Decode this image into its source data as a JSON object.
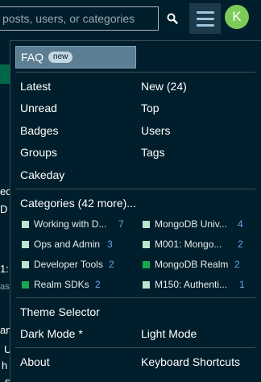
{
  "header": {
    "search_placeholder": "posts, users, or categories",
    "avatar_letter": "K"
  },
  "page_edge": {
    "lines": [
      "ed",
      "D",
      "1:",
      "asi",
      "an",
      "U",
      "h",
      "s"
    ]
  },
  "menu": {
    "faq": {
      "label": "FAQ",
      "badge": "new"
    },
    "links_left": [
      "Latest",
      "Unread",
      "Badges",
      "Groups",
      "Cakeday"
    ],
    "links_right": [
      "New (24)",
      "Top",
      "Users",
      "Tags"
    ],
    "categories_heading": "Categories (42 more)...",
    "categories": [
      {
        "name": "Working with D...",
        "count": "7",
        "color": "#b8e6cf"
      },
      {
        "name": "MongoDB Univ...",
        "count": "4",
        "color": "#b8e6cf"
      },
      {
        "name": "Ops and Admin",
        "count": "3",
        "color": "#b8e6cf"
      },
      {
        "name": "M001: Mongo...",
        "count": "2",
        "color": "#b8e6cf"
      },
      {
        "name": "Developer Tools",
        "count": "2",
        "color": "#b8e6cf"
      },
      {
        "name": "MongoDB Realm",
        "count": "2",
        "color": "#13aa52"
      },
      {
        "name": "Realm SDKs",
        "count": "2",
        "color": "#13aa52"
      },
      {
        "name": "M150: Authenti...",
        "count": "1",
        "color": "#b8e6cf"
      }
    ],
    "theme_selector": "Theme Selector",
    "dark_mode": "Dark Mode *",
    "light_mode": "Light Mode",
    "about": "About",
    "keyboard_shortcuts": "Keyboard Shortcuts"
  }
}
